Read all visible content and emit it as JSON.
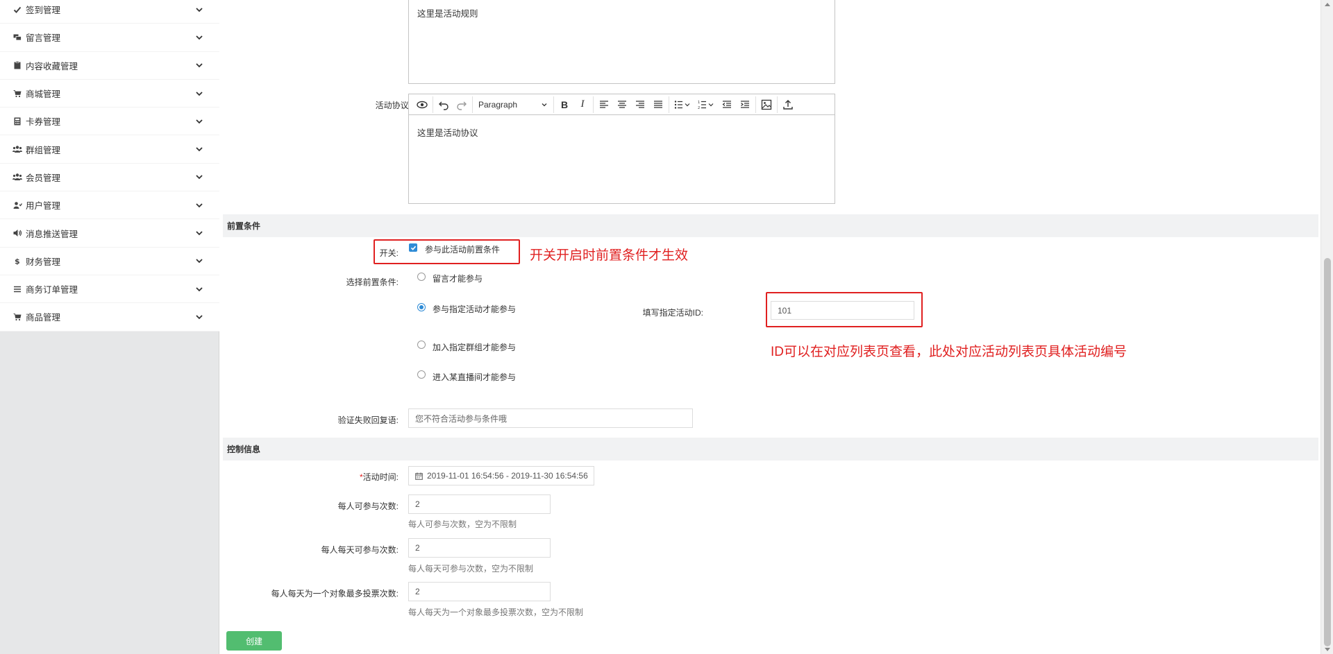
{
  "sidebar": {
    "items": [
      {
        "label": "签到管理",
        "icon": "check-icon"
      },
      {
        "label": "留言管理",
        "icon": "comments-icon"
      },
      {
        "label": "内容收藏管理",
        "icon": "clipboard-icon"
      },
      {
        "label": "商城管理",
        "icon": "cart-icon"
      },
      {
        "label": "卡券管理",
        "icon": "calculator-icon"
      },
      {
        "label": "群组管理",
        "icon": "group-icon"
      },
      {
        "label": "会员管理",
        "icon": "group-icon"
      },
      {
        "label": "用户管理",
        "icon": "user-icon"
      },
      {
        "label": "消息推送管理",
        "icon": "volume-icon"
      },
      {
        "label": "财务管理",
        "icon": "dollar-icon"
      },
      {
        "label": "商务订单管理",
        "icon": "list-icon"
      },
      {
        "label": "商品管理",
        "icon": "cart-icon"
      }
    ]
  },
  "rules": {
    "content": "这里是活动规则"
  },
  "agreement": {
    "label": "活动协议:",
    "content": "这里是活动协议",
    "paragraph_select": "Paragraph"
  },
  "precondition": {
    "section_title": "前置条件",
    "switch_label": "开关:",
    "switch_checkbox_label": "参与此活动前置条件",
    "select_label": "选择前置条件:",
    "options": [
      {
        "label": "留言才能参与",
        "checked": false
      },
      {
        "label": "参与指定活动才能参与",
        "checked": true
      },
      {
        "label": "加入指定群组才能参与",
        "checked": false
      },
      {
        "label": "进入某直播间才能参与",
        "checked": false
      }
    ],
    "activity_id_label": "填写指定活动ID:",
    "activity_id_value": "101",
    "fail_reply_label": "验证失败回复语:",
    "fail_reply_placeholder": "您不符合活动参与条件哦"
  },
  "annotations": {
    "switch_note": "开关开启时前置条件才生效",
    "id_note": "ID可以在对应列表页查看，此处对应活动列表页具体活动编号"
  },
  "control": {
    "section_title": "控制信息",
    "time_required": "*",
    "time_label": "活动时间:",
    "time_value": "2019-11-01 16:54:56 - 2019-11-30 16:54:56",
    "per_person_label": "每人可参与次数:",
    "per_person_value": "2",
    "per_person_help": "每人可参与次数，空为不限制",
    "per_day_label": "每人每天可参与次数:",
    "per_day_value": "2",
    "per_day_help": "每人每天可参与次数，空为不限制",
    "vote_label": "每人每天为一个对象最多投票次数:",
    "vote_value": "2",
    "vote_help": "每人每天为一个对象最多投票次数，空为不限制"
  },
  "create_button": "创建",
  "colors": {
    "accent": "#2e8bd6",
    "create": "#52bd70",
    "annotation": "#e02020"
  }
}
